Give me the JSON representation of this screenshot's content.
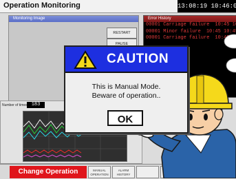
{
  "app": {
    "title": "Operation Monitoring",
    "clock": "13:08:19 10:46:06"
  },
  "monitoring": {
    "header": "Monitoring Image",
    "restart_label": "RESTART",
    "pause_label": "PAUSE"
  },
  "error_history": {
    "header": "Error History",
    "rows": [
      {
        "code": "00001 Carriage failure",
        "time": "10:45 10:45"
      },
      {
        "code": "00001 Minor failure",
        "time": "10:45 10:45"
      },
      {
        "code": "00001 Carriage failure",
        "time": "10:45 10:45"
      }
    ]
  },
  "chart": {
    "count_label": "Number of times",
    "count_value": "183"
  },
  "dialog": {
    "title": "CAUTION",
    "line1": "This is Manual Mode.",
    "line2": "Beware of operation..",
    "ok_label": "OK"
  },
  "bottom": {
    "change_operation": "Change Operation",
    "manual_l1": "MANUAL",
    "manual_l2": "OPERATION",
    "alarm_l1": "ALARM",
    "alarm_l2": "HISTORY"
  },
  "colors": {
    "dialog_header": "#1d2fe0",
    "change_op": "#e0151b",
    "error_text": "#e23a3a"
  }
}
